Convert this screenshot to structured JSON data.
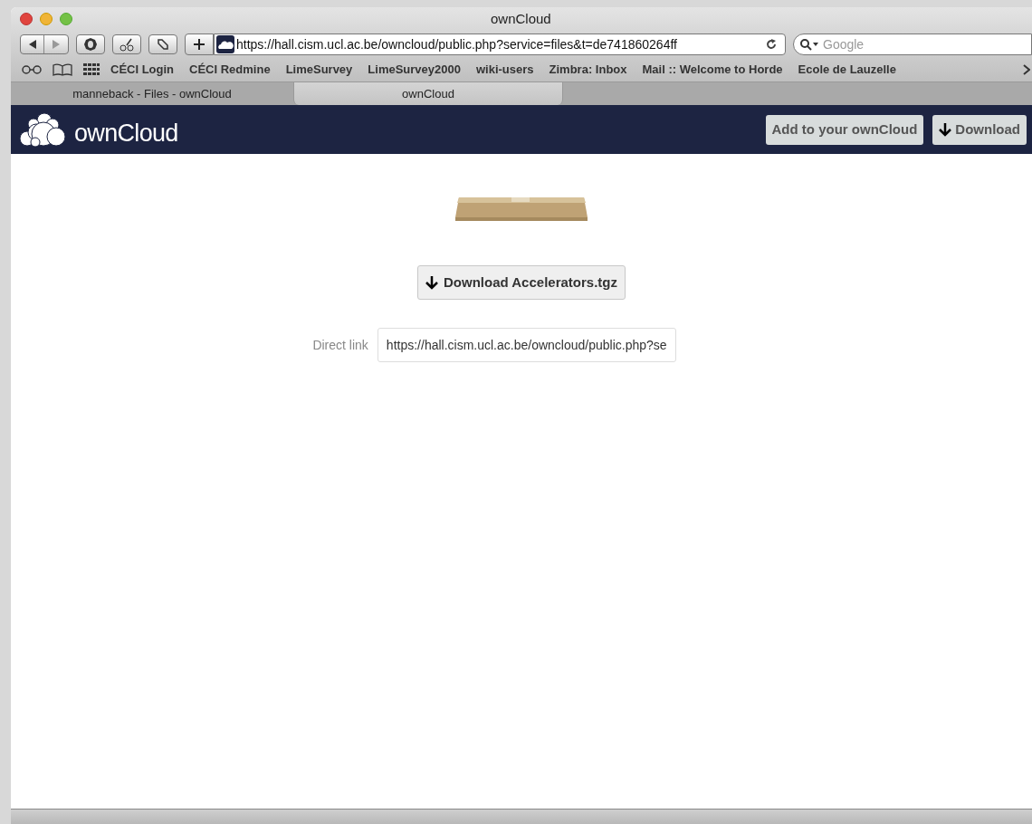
{
  "window": {
    "title": "ownCloud"
  },
  "toolbar": {
    "url": "https://hall.cism.ucl.ac.be/owncloud/public.php?service=files&t=de741860264ff",
    "search_placeholder": "Google"
  },
  "bookmarks": [
    "CÉCI Login",
    "CÉCI Redmine",
    "LimeSurvey",
    "LimeSurvey2000",
    "wiki-users",
    "Zimbra: Inbox",
    "Mail :: Welcome to Horde",
    "Ecole de Lauzelle"
  ],
  "tabs": [
    {
      "label": "manneback - Files - ownCloud",
      "selected": false
    },
    {
      "label": "ownCloud",
      "selected": true
    }
  ],
  "header": {
    "logo_text": "ownCloud",
    "buttons": [
      {
        "label": "Add to your ownCloud",
        "kind": "plain"
      },
      {
        "label": "Download",
        "kind": "download"
      }
    ]
  },
  "content": {
    "download_button": "Download Accelerators.tgz",
    "direct_link": {
      "label": "Direct link",
      "value": "https://hall.cism.ucl.ac.be/owncloud/public.php?se"
    }
  }
}
